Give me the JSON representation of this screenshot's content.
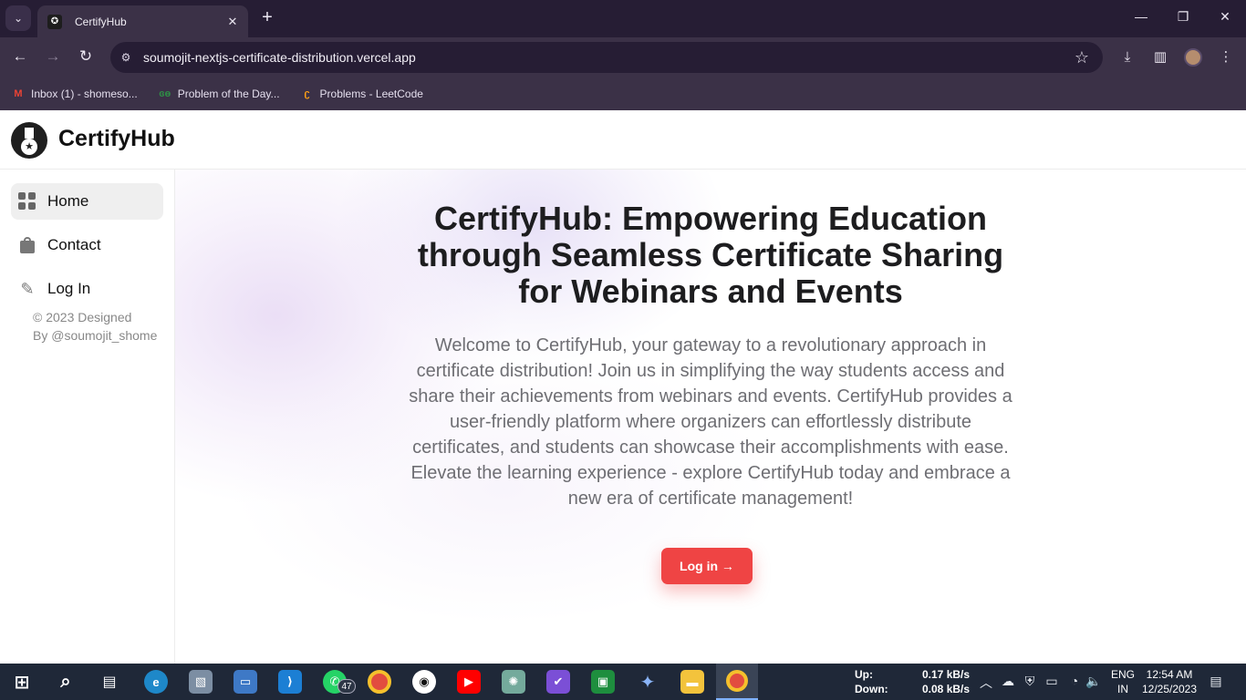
{
  "browser": {
    "tab_title": "CertifyHub",
    "url": "soumojit-nextjs-certificate-distribution.vercel.app",
    "bookmarks": [
      {
        "label": "Inbox (1) - shomeso...",
        "icon": "gmail-icon",
        "color": "#ea4335"
      },
      {
        "label": "Problem of the Day...",
        "icon": "gfg-icon",
        "color": "#2f8d46"
      },
      {
        "label": "Problems - LeetCode",
        "icon": "leetcode-icon",
        "color": "#ffa116"
      }
    ]
  },
  "header": {
    "brand": "CertifyHub"
  },
  "sidebar": {
    "items": [
      {
        "label": "Home",
        "icon": "grid-icon",
        "active": true
      },
      {
        "label": "Contact",
        "icon": "bag-icon",
        "active": false
      },
      {
        "label": "Log In",
        "icon": "login-icon",
        "active": false
      }
    ],
    "credit_line1": "© 2023 Designed",
    "credit_line2": "By @soumojit_shome"
  },
  "main": {
    "headline": "CertifyHub: Empowering Education through Seamless Certificate Sharing for Webinars and Events",
    "intro": "Welcome to CertifyHub, your gateway to a revolutionary approach in certificate distribution! Join us in simplifying the way students access and share their achievements from webinars and events. CertifyHub provides a user-friendly platform where organizers can effortlessly distribute certificates, and students can showcase their accomplishments with ease. Elevate the learning experience - explore CertifyHub today and embrace a new era of certificate management!",
    "cta_label": "Log in →",
    "accent_color": "#ef4444"
  },
  "taskbar": {
    "whatsapp_badge": "47",
    "net_up_label": "Up:",
    "net_down_label": "Down:",
    "net_up_value": "0.17 kB/s",
    "net_down_value": "0.08 kB/s",
    "lang_line1": "ENG",
    "lang_line2": "IN",
    "time": "12:54 AM",
    "date": "12/25/2023"
  }
}
